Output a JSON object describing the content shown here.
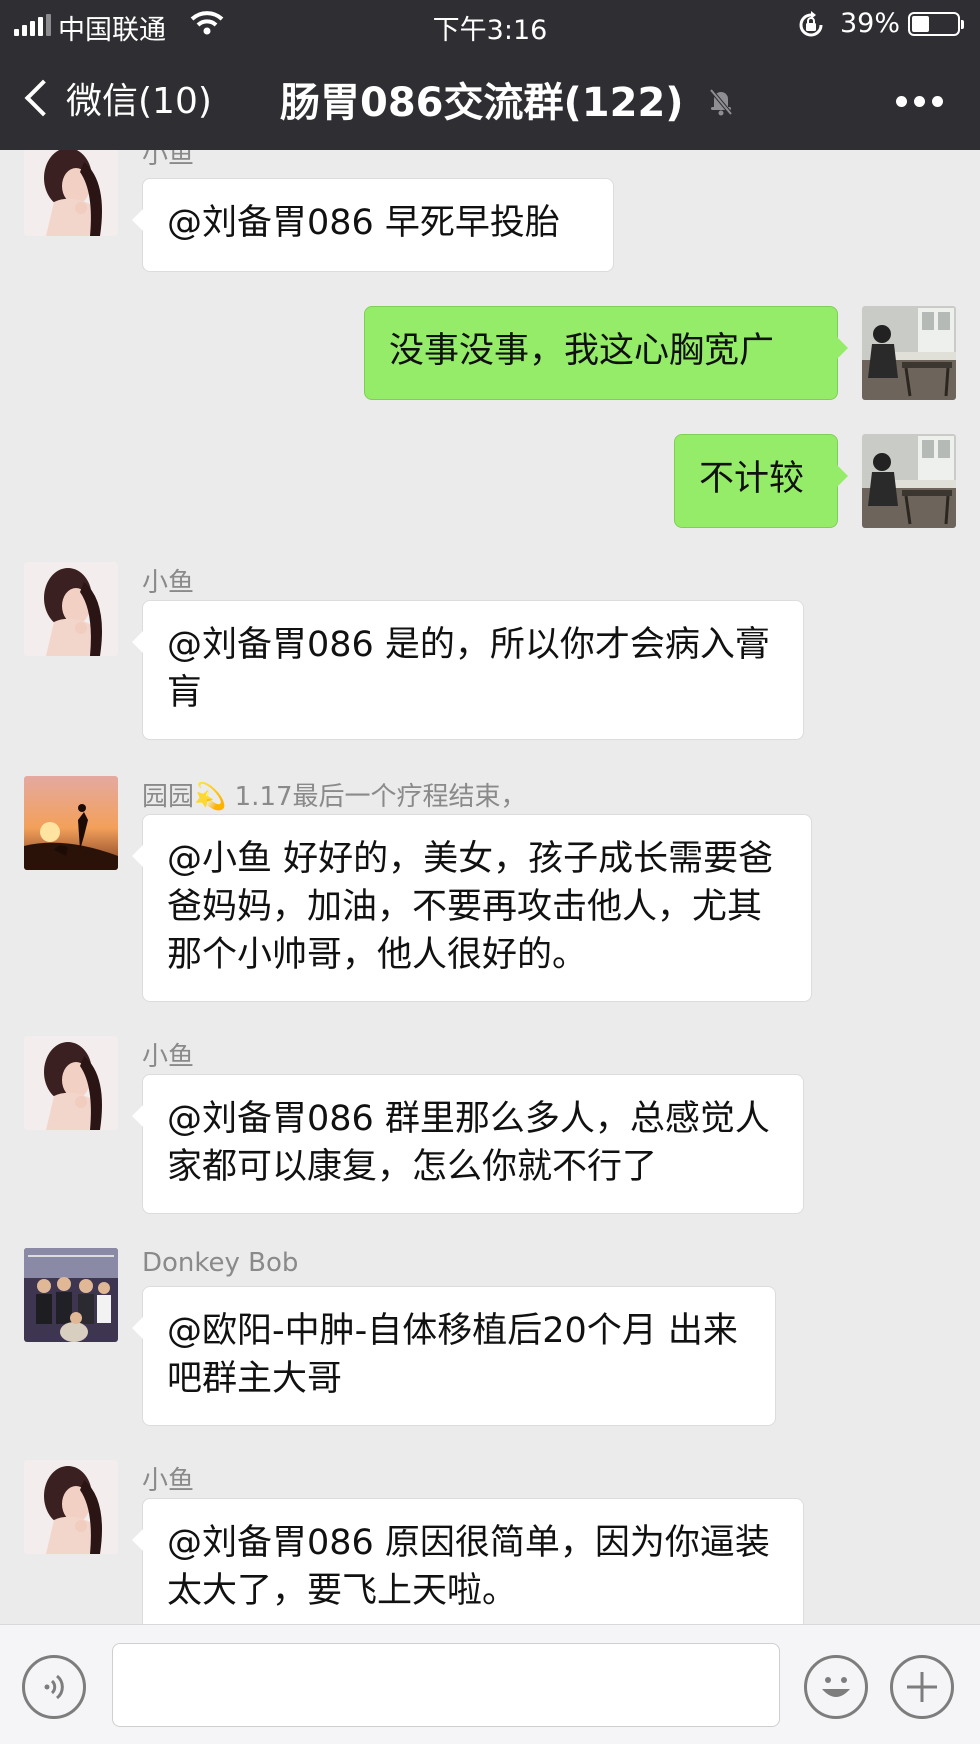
{
  "status_bar": {
    "carrier": "中国联通",
    "time": "下午3:16",
    "battery_pct": "39%",
    "battery_level": 0.39
  },
  "nav": {
    "back_label": "微信(10)",
    "title": "肠胃086交流群(122)",
    "icons": [
      "back-chevron-icon",
      "mute-bell-icon",
      "more-icon"
    ]
  },
  "messages": [
    {
      "side": "in",
      "sender": "小鱼",
      "avatar": "girl",
      "text": "@刘备胃086 早死早投胎"
    },
    {
      "side": "out",
      "sender": "",
      "avatar": "me",
      "text": "没事没事，我这心胸宽广"
    },
    {
      "side": "out",
      "sender": "",
      "avatar": "me",
      "text": "不计较"
    },
    {
      "side": "in",
      "sender": "小鱼",
      "avatar": "girl",
      "text": "@刘备胃086 是的，所以你才会病入膏肓"
    },
    {
      "side": "in",
      "sender": "园园💫 1.17最后一个疗程结束，",
      "avatar": "sunset",
      "text": "@小鱼 好好的，美女，孩子成长需要爸爸妈妈，加油，不要再攻击他人，尤其那个小帅哥，他人很好的。"
    },
    {
      "side": "in",
      "sender": "小鱼",
      "avatar": "girl",
      "text": "@刘备胃086 群里那么多人，总感觉人家都可以康复，怎么你就不行了"
    },
    {
      "side": "in",
      "sender": "Donkey Bob",
      "avatar": "group",
      "text": "@欧阳-中肿-自体移植后20个月 出来吧群主大哥"
    },
    {
      "side": "in",
      "sender": "小鱼",
      "avatar": "girl",
      "text": "@刘备胃086 原因很简单，因为你逼装太大了，要飞上天啦。"
    }
  ],
  "input_bar": {
    "text_value": "",
    "icons": [
      "voice-icon",
      "emoji-icon",
      "plus-icon"
    ]
  },
  "colors": {
    "nav_bg": "#2f2f33",
    "chat_bg": "#ebebeb",
    "outgoing_bubble": "#95ec69",
    "incoming_bubble": "#ffffff"
  }
}
